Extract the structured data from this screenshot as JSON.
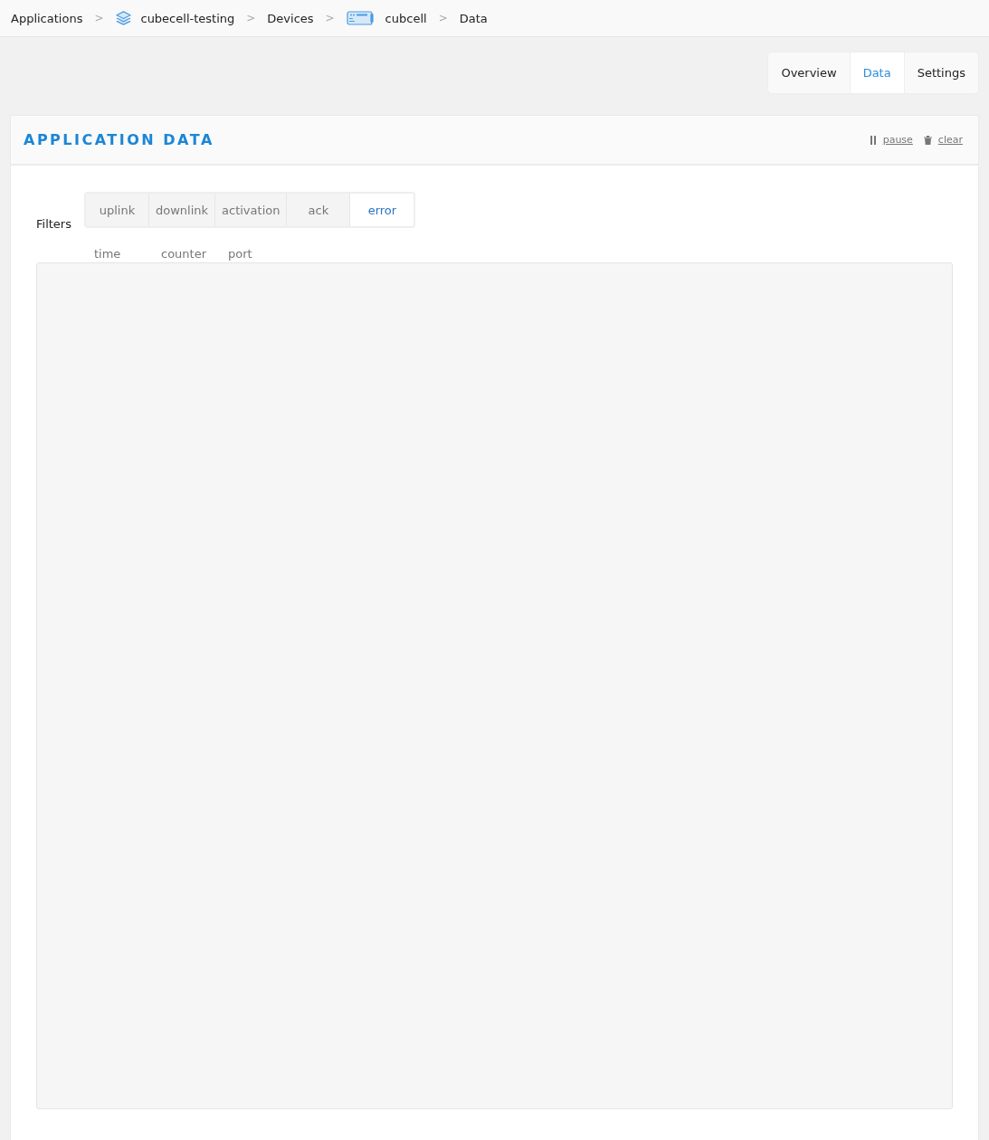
{
  "breadcrumb": [
    {
      "label": "Applications",
      "kind": "plain"
    },
    {
      "label": "cubecell-testing",
      "kind": "application"
    },
    {
      "label": "Devices",
      "kind": "plain"
    },
    {
      "label": "cubcell",
      "kind": "device"
    },
    {
      "label": "Data",
      "kind": "plain"
    }
  ],
  "separator": ">",
  "tabs": [
    {
      "label": "Overview",
      "selected": false
    },
    {
      "label": "Data",
      "selected": true
    },
    {
      "label": "Settings",
      "selected": false
    }
  ],
  "panel": {
    "title": "APPLICATION DATA",
    "actions": [
      {
        "label": "pause",
        "kind": "pause"
      },
      {
        "label": "clear",
        "kind": "clear"
      }
    ]
  },
  "filters": {
    "label": "Filters",
    "items": [
      {
        "label": "uplink",
        "selected": false
      },
      {
        "label": "downlink",
        "selected": false
      },
      {
        "label": "activation",
        "selected": false
      },
      {
        "label": "ack",
        "selected": false
      },
      {
        "label": "error",
        "selected": true
      }
    ]
  },
  "table": {
    "columns": [
      "time",
      "counter",
      "port"
    ]
  }
}
